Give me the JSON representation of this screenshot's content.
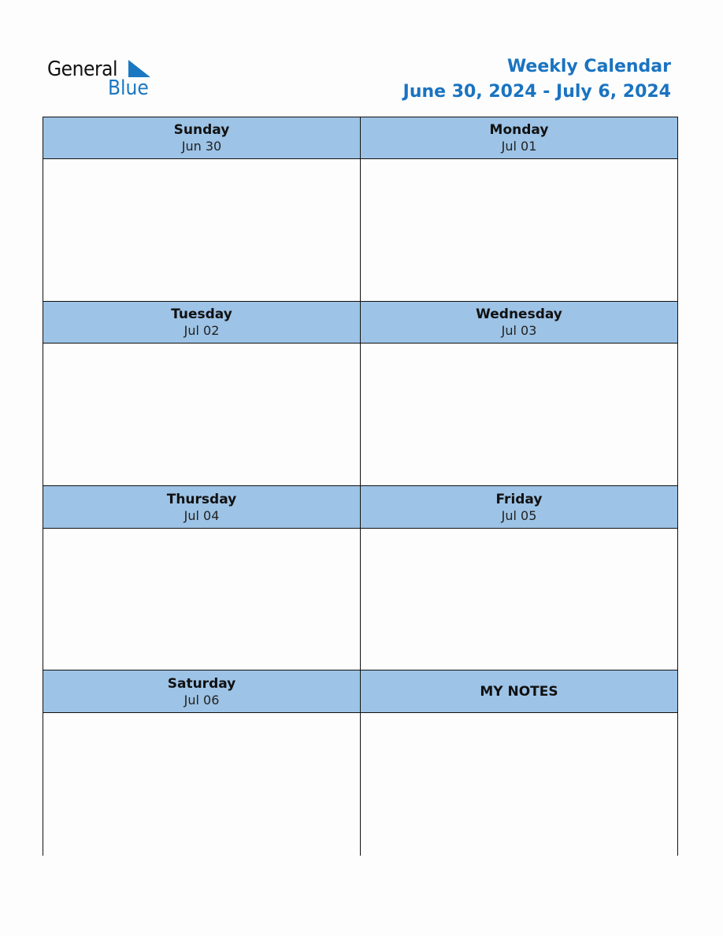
{
  "logo": {
    "word1": "General",
    "word2": "Blue",
    "icon": "triangle-flag-icon",
    "accent_color": "#1a78c2"
  },
  "header": {
    "title": "Weekly Calendar",
    "date_range": "June 30, 2024 - July 6, 2024",
    "title_color": "#1a73c1"
  },
  "header_bg_color": "#9dc3e6",
  "days": [
    {
      "name": "Sunday",
      "date": "Jun 30"
    },
    {
      "name": "Monday",
      "date": "Jul 01"
    },
    {
      "name": "Tuesday",
      "date": "Jul 02"
    },
    {
      "name": "Wednesday",
      "date": "Jul 03"
    },
    {
      "name": "Thursday",
      "date": "Jul 04"
    },
    {
      "name": "Friday",
      "date": "Jul 05"
    },
    {
      "name": "Saturday",
      "date": "Jul 06"
    }
  ],
  "notes": {
    "label": "MY NOTES"
  }
}
